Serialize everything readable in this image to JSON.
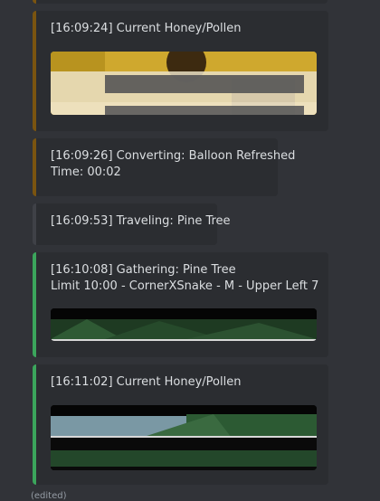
{
  "messages": [
    {
      "desc": "[16:09:24] Current Honey/Pollen",
      "accent": "#7a5410"
    },
    {
      "desc": "[16:09:26] Converting: Balloon Refreshed\nTime: 00:02",
      "accent": "#7a5410"
    },
    {
      "desc": "[16:09:53] Traveling: Pine Tree",
      "accent": "#3f4147"
    },
    {
      "desc": "[16:10:08] Gathering: Pine Tree\nLimit 10:00 - CornerXSnake - M - Upper Left 7",
      "accent": "#3ba55c"
    },
    {
      "desc": "[16:11:02] Current Honey/Pollen",
      "accent": "#3ba55c"
    }
  ],
  "footer": {
    "edited": "(edited)"
  },
  "colors": {
    "background": "#313338",
    "embed": "#2b2d31",
    "text": "#dbdee1"
  }
}
